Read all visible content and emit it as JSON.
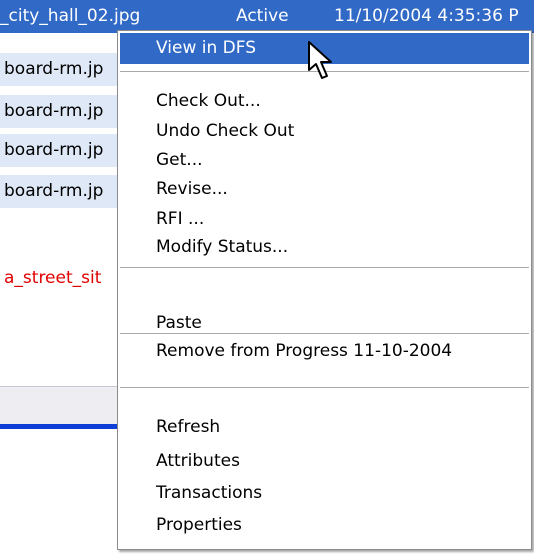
{
  "list": {
    "rows": [
      {
        "name": "_city_hall_02.jpg",
        "status": "Active",
        "date": "11/10/2004 4:35:36 P"
      },
      {
        "name": "board-rm.jp"
      },
      {
        "name": "board-rm.jp"
      },
      {
        "name": "board-rm.jp"
      },
      {
        "name": "board-rm.jp"
      },
      {
        "name": "a_street_sit"
      }
    ],
    "colors": {
      "selected_bg": "#3169c6",
      "alt_bg": "#dee8f6",
      "red_text": "#e00000"
    }
  },
  "menu": {
    "items": [
      {
        "label": "View in DFS",
        "highlighted": true
      },
      {
        "label": "Check Out..."
      },
      {
        "label": "Undo Check Out"
      },
      {
        "label": "Get..."
      },
      {
        "label": "Revise..."
      },
      {
        "label": "RFI ..."
      },
      {
        "label": "Modify Status..."
      },
      {
        "label": "Paste"
      },
      {
        "label": "Remove from Progress 11-10-2004"
      },
      {
        "label": "Refresh"
      },
      {
        "label": "Attributes"
      },
      {
        "label": "Transactions"
      },
      {
        "label": "Properties"
      }
    ],
    "highlight_color": "#3169c6"
  },
  "cursor": {
    "icon": "arrow-pointer-icon"
  }
}
